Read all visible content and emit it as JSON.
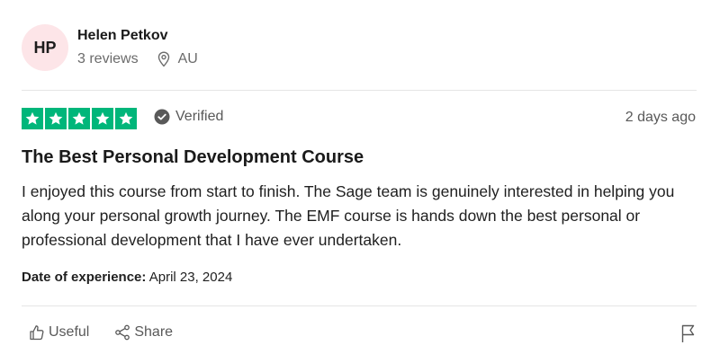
{
  "reviewer": {
    "initials": "HP",
    "name": "Helen Petkov",
    "reviews": "3 reviews",
    "location": "AU",
    "avatar_bg": "#fde5e8"
  },
  "review": {
    "rating": 5,
    "star_color": "#00b67a",
    "verified_label": "Verified",
    "posted": "2 days ago",
    "title": "The Best Personal Development Course",
    "body": "I enjoyed this course from start to finish. The Sage team is genuinely interested in helping you along your personal growth journey. The EMF course is hands down the best personal or professional development that I have ever undertaken.",
    "experience_label": "Date of experience:",
    "experience_date": "April 23, 2024"
  },
  "actions": {
    "useful_label": "Useful",
    "share_label": "Share",
    "icons": [
      "thumbs-up-icon",
      "share-icon",
      "flag-icon"
    ]
  }
}
